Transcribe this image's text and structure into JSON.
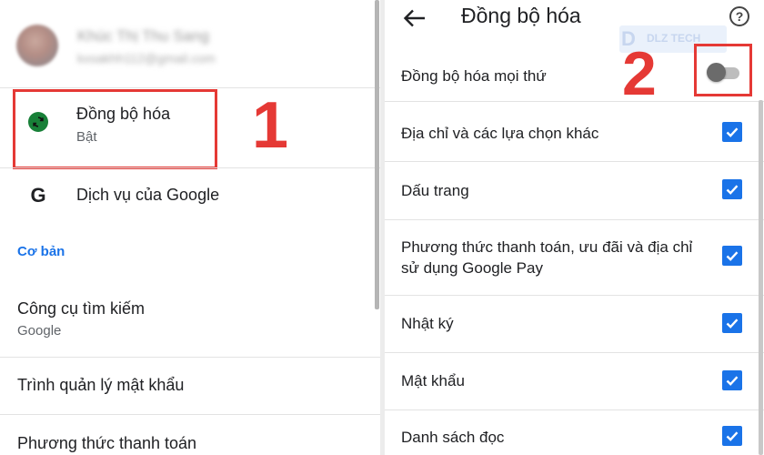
{
  "left": {
    "account": {
      "name": "Khúc Thị Thu Sang",
      "email": "kxsakhh112@gmail.com"
    },
    "sync": {
      "title": "Đồng bộ hóa",
      "subtitle": "Bật"
    },
    "step1": "1",
    "google_services": {
      "icon": "G",
      "label": "Dịch vụ của Google"
    },
    "basic_header": "Cơ bản",
    "search_engine": {
      "title": "Công cụ tìm kiếm",
      "subtitle": "Google"
    },
    "password_manager": {
      "label": "Trình quản lý mật khẩu"
    },
    "payment": {
      "label": "Phương thức thanh toán"
    }
  },
  "right": {
    "title": "Đồng bộ hóa",
    "help_glyph": "?",
    "watermark": {
      "logo": "D",
      "text": "DLZ TECH"
    },
    "sync_everything": {
      "label": "Đồng bộ hóa mọi thứ",
      "on": false
    },
    "step2": "2",
    "items": [
      {
        "label": "Địa chỉ và các lựa chọn khác",
        "checked": true
      },
      {
        "label": "Dấu trang",
        "checked": true
      },
      {
        "label": "Phương thức thanh toán, ưu đãi và địa chỉ sử dụng Google Pay",
        "checked": true
      },
      {
        "label": "Nhật ký",
        "checked": true
      },
      {
        "label": "Mật khẩu",
        "checked": true
      },
      {
        "label": "Danh sách đọc",
        "checked": true
      }
    ]
  },
  "colors": {
    "accent_blue": "#1a73e8",
    "sync_green": "#188038",
    "highlight_red": "#e53935"
  }
}
